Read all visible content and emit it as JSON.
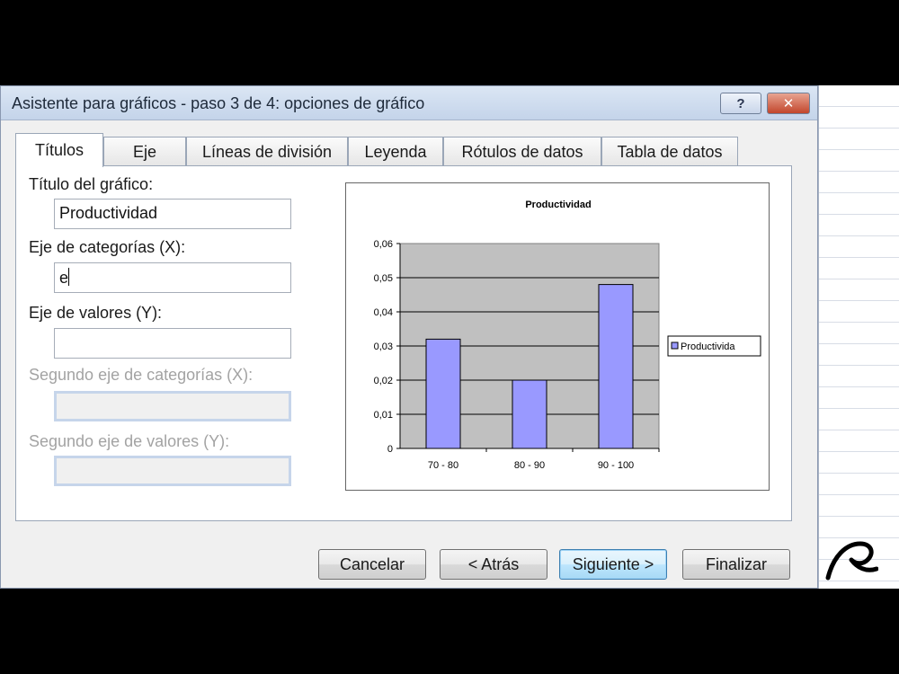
{
  "dialog": {
    "title": "Asistente para gráficos - paso 3 de 4: opciones de gráfico",
    "help_label": "?",
    "close_label": "✕"
  },
  "tabs": [
    {
      "label": "Títulos",
      "active": true
    },
    {
      "label": "Eje"
    },
    {
      "label": "Líneas de división"
    },
    {
      "label": "Leyenda"
    },
    {
      "label": "Rótulos de datos"
    },
    {
      "label": "Tabla de datos"
    }
  ],
  "form": {
    "chart_title_label": "Título del gráfico:",
    "chart_title_value": "Productividad",
    "category_axis_label": "Eje de categorías (X):",
    "category_axis_value": "e",
    "value_axis_label": "Eje de valores (Y):",
    "value_axis_value": "",
    "second_category_axis_label": "Segundo eje de categorías (X):",
    "second_value_axis_label": "Segundo eje de valores (Y):"
  },
  "buttons": {
    "cancel": "Cancelar",
    "back": "< Atrás",
    "next": "Siguiente >",
    "finish": "Finalizar"
  },
  "colors": {
    "plot_area": "#c0c0c0",
    "bar": "#9999ff",
    "accent_close": "#c2462c"
  },
  "chart_data": {
    "type": "bar",
    "title": "Productividad",
    "categories": [
      "70 - 80",
      "80 - 90",
      "90 - 100"
    ],
    "series": [
      {
        "name": "Productividad",
        "values": [
          0.032,
          0.02,
          0.048
        ]
      }
    ],
    "y_ticks": [
      "0,06",
      "0,05",
      "0,04",
      "0,03",
      "0,02",
      "0,01",
      "0"
    ],
    "ylim": [
      0,
      0.06
    ],
    "grid": true,
    "legend_position": "right",
    "legend_label": "Productivida"
  }
}
